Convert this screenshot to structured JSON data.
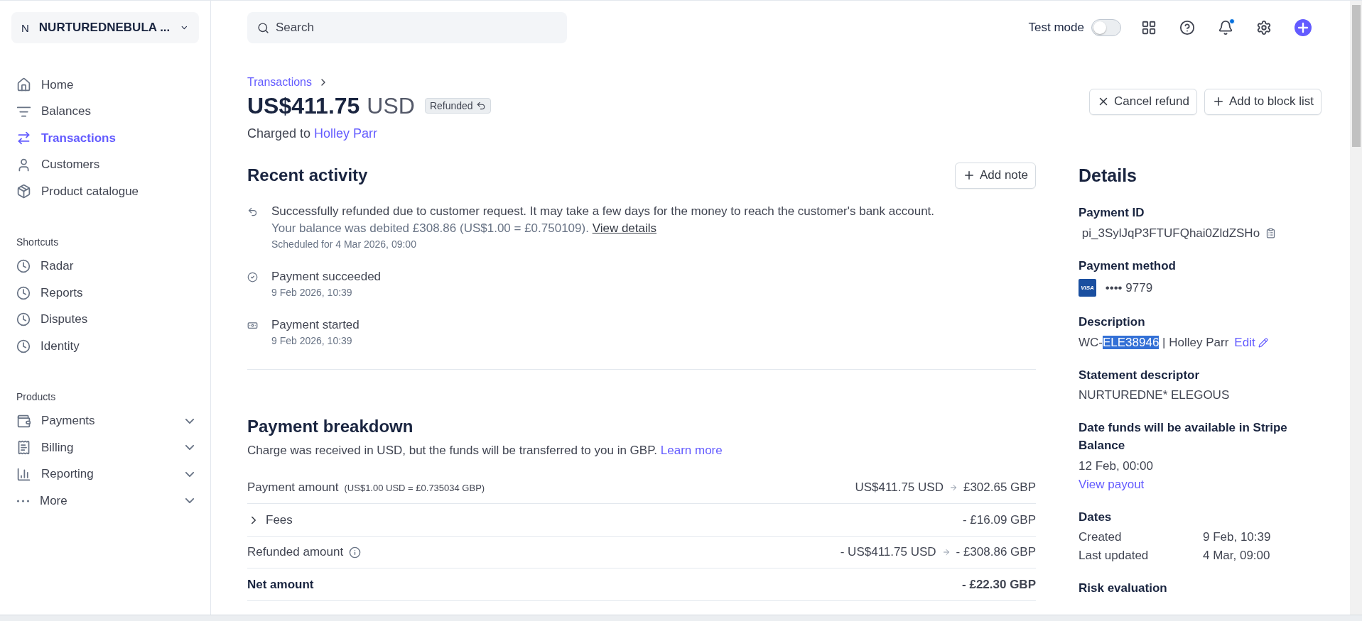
{
  "account": {
    "initial": "N",
    "name": "NURTUREDNEBULA ..."
  },
  "nav": [
    {
      "label": "Home",
      "selected": false
    },
    {
      "label": "Balances",
      "selected": false
    },
    {
      "label": "Transactions",
      "selected": true
    },
    {
      "label": "Customers",
      "selected": false
    },
    {
      "label": "Product catalogue",
      "selected": false
    }
  ],
  "shortcuts": {
    "heading": "Shortcuts",
    "items": [
      {
        "label": "Radar"
      },
      {
        "label": "Reports"
      },
      {
        "label": "Disputes"
      },
      {
        "label": "Identity"
      }
    ]
  },
  "products": {
    "heading": "Products",
    "items": [
      {
        "label": "Payments"
      },
      {
        "label": "Billing"
      },
      {
        "label": "Reporting"
      },
      {
        "label": "More"
      }
    ]
  },
  "topbar": {
    "search_placeholder": "Search",
    "test_mode": {
      "label": "Test mode",
      "on": false
    },
    "notifications_unread": true
  },
  "breadcrumb": "Transactions",
  "amount": "US$411.75",
  "currency": "USD",
  "status": "Refunded",
  "charged_to": {
    "label": "Charged to",
    "name": "Holley Parr"
  },
  "actions": [
    {
      "label": "Cancel refund"
    },
    {
      "label": "Add to block list"
    }
  ],
  "activity": {
    "title": "Recent activity",
    "add_note": "Add note",
    "events": [
      {
        "kind": "refund",
        "title": "Successfully refunded due to customer request. It may take a few days for the money to reach the customer's bank account.",
        "note": "Your balance was debited £308.86 (US$1.00 = £0.750109).",
        "link": "View details",
        "time": "Scheduled for 4 Mar 2026, 09:00"
      },
      {
        "kind": "succeeded",
        "title": "Payment succeeded",
        "time": "9 Feb 2026, 10:39"
      },
      {
        "kind": "started",
        "title": "Payment started",
        "time": "9 Feb 2026, 10:39"
      }
    ]
  },
  "breakdown": {
    "title": "Payment breakdown",
    "subtitle": "Charge was received in USD, but the funds will be transferred to you in GBP.",
    "link": "Learn more",
    "rows": [
      {
        "kind": "amount",
        "label": "Payment amount",
        "rate": "(US$1.00 USD = £0.735034 GBP)",
        "from": "US$411.75 USD",
        "to": "£302.65 GBP"
      },
      {
        "kind": "fees",
        "label": "Fees",
        "expanded": false,
        "to": "- £16.09 GBP"
      },
      {
        "kind": "refund",
        "label": "Refunded amount",
        "from": "- US$411.75 USD",
        "to": "- £308.86 GBP"
      },
      {
        "kind": "net",
        "label": "Net amount",
        "to": "- £22.30 GBP"
      }
    ]
  },
  "details": {
    "title": "Details",
    "payment_id": {
      "label": "Payment ID",
      "value": "pi_3SylJqP3FTUFQhai0ZldZSHo"
    },
    "payment_method": {
      "label": "Payment method",
      "brand": "VISA",
      "value": "•••• 9779"
    },
    "description": {
      "label": "Description",
      "prefix": "WC-",
      "highlighted": "ELE38946",
      "suffix": " | Holley Parr",
      "edit": "Edit"
    },
    "statement": {
      "label": "Statement descriptor",
      "value": "NURTUREDNE* ELEGOUS"
    },
    "funds": {
      "label": "Date funds will be available in Stripe Balance",
      "value": "12 Feb, 00:00",
      "link": "View payout"
    },
    "dates": {
      "label": "Dates",
      "rows": [
        {
          "name": "Created",
          "value": "9 Feb, 10:39"
        },
        {
          "name": "Last updated",
          "value": "4 Mar, 09:00"
        }
      ]
    },
    "risk": {
      "label": "Risk evaluation"
    }
  }
}
